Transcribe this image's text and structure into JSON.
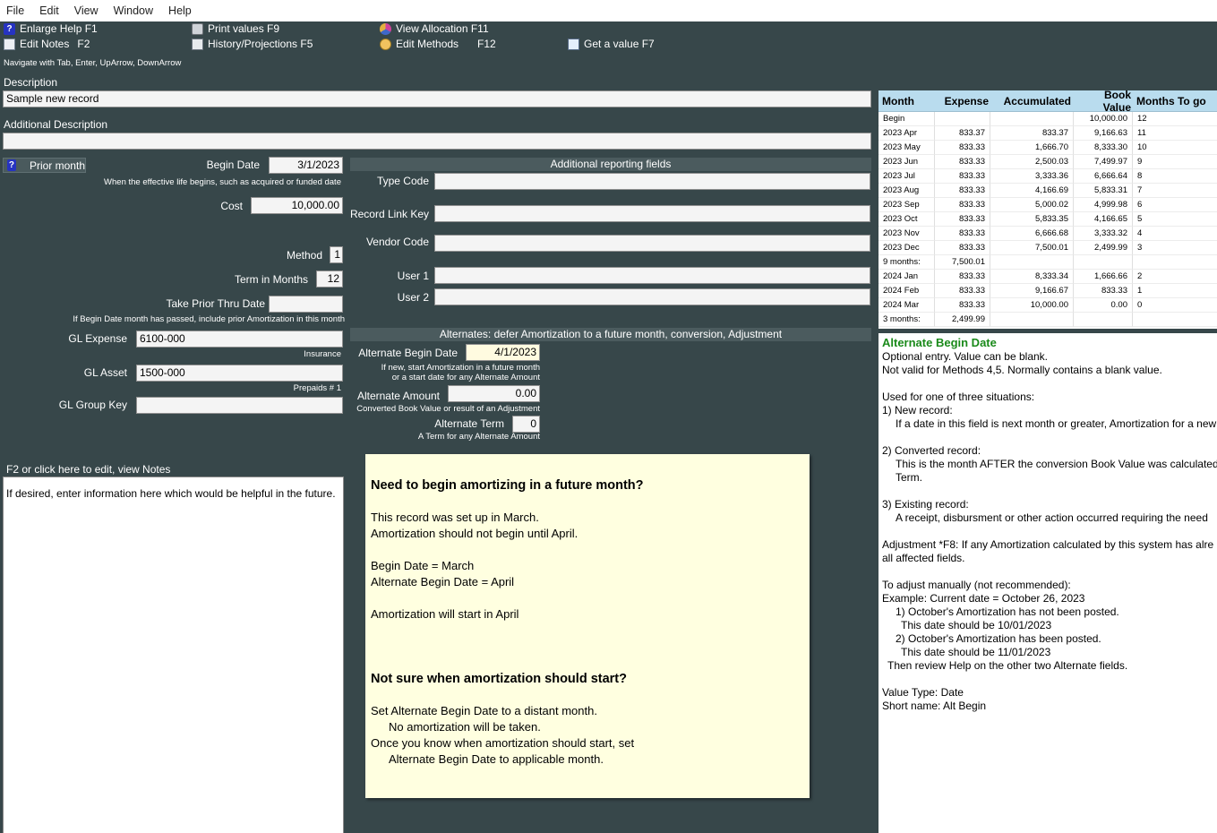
{
  "menu": [
    "File",
    "Edit",
    "View",
    "Window",
    "Help"
  ],
  "toolbar": {
    "enlarge_help": "Enlarge Help F1",
    "edit_notes": "Edit Notes",
    "edit_notes_key": "F2",
    "print_values": "Print values  F9",
    "history": "History/Projections  F5",
    "view_allocation": "View Allocation  F11",
    "edit_methods": "Edit Methods",
    "edit_methods_key": "F12",
    "get_value": "Get a value  F7"
  },
  "nav_hint": "Navigate with Tab, Enter, UpArrow, DownArrow",
  "description": {
    "label": "Description",
    "value": "Sample new record"
  },
  "additional_description": {
    "label": "Additional Description",
    "value": ""
  },
  "prior_month": {
    "icon": "?",
    "label": "Prior month"
  },
  "begin_date": {
    "label": "Begin Date",
    "value": "3/1/2023",
    "hint": "When the effective life begins, such as acquired or funded date"
  },
  "cost": {
    "label": "Cost",
    "value": "10,000.00"
  },
  "method": {
    "label": "Method",
    "value": "1"
  },
  "term": {
    "label": "Term in Months",
    "value": "12"
  },
  "take_prior": {
    "label": "Take Prior Thru Date",
    "value": "",
    "hint": "If Begin Date month has passed, include prior Amortization in this month"
  },
  "gl_expense": {
    "label": "GL Expense",
    "value": "6100-000",
    "desc": "Insurance"
  },
  "gl_asset": {
    "label": "GL Asset",
    "value": "1500-000",
    "desc": "Prepaids  # 1"
  },
  "gl_group": {
    "label": "GL Group Key",
    "value": ""
  },
  "notes": {
    "header": "F2 or click here to edit, view Notes",
    "text": "If desired, enter information here which would be helpful in the future."
  },
  "reporting": {
    "title": "Additional reporting fields",
    "type_code": {
      "label": "Type Code",
      "value": ""
    },
    "record_link": {
      "label": "Record Link Key",
      "value": ""
    },
    "vendor_code": {
      "label": "Vendor Code",
      "value": ""
    },
    "user1": {
      "label": "User 1",
      "value": ""
    },
    "user2": {
      "label": "User 2",
      "value": ""
    }
  },
  "alternates": {
    "title": "Alternates: defer Amortization to a future month, conversion, Adjustment",
    "begin_date": {
      "label": "Alternate Begin Date",
      "value": "4/1/2023",
      "hint1": "If new, start Amortization in a future month",
      "hint2": "or a start date for any Alternate Amount"
    },
    "amount": {
      "label": "Alternate Amount",
      "value": "0.00",
      "hint": "Converted Book Value or result of an Adjustment"
    },
    "term": {
      "label": "Alternate Term",
      "value": "0",
      "hint": "A Term for any Alternate Amount"
    }
  },
  "infobox": {
    "h1": "Need to begin amortizing in a future month?",
    "p1": "This record was set up in March.",
    "p2": "Amortization should not begin until April.",
    "p3": "Begin Date = March",
    "p4": "Alternate Begin Date = April",
    "p5": "Amortization will start in April",
    "h2": "Not sure when amortization should start?",
    "p6": "Set Alternate Begin Date to a distant month.",
    "p7": "No amortization will be taken.",
    "p8": "Once you know when amortization should start, set",
    "p9": "Alternate Begin Date to applicable month."
  },
  "schedule": {
    "headers": [
      "Month",
      "Expense",
      "Accumulated",
      "Book Value",
      "Months To go"
    ],
    "rows": [
      [
        "Begin",
        "",
        "",
        "10,000.00",
        "12"
      ],
      [
        "2023 Apr",
        "833.37",
        "833.37",
        "9,166.63",
        "11"
      ],
      [
        "2023 May",
        "833.33",
        "1,666.70",
        "8,333.30",
        "10"
      ],
      [
        "2023 Jun",
        "833.33",
        "2,500.03",
        "7,499.97",
        "9"
      ],
      [
        "2023 Jul",
        "833.33",
        "3,333.36",
        "6,666.64",
        "8"
      ],
      [
        "2023 Aug",
        "833.33",
        "4,166.69",
        "5,833.31",
        "7"
      ],
      [
        "2023 Sep",
        "833.33",
        "5,000.02",
        "4,999.98",
        "6"
      ],
      [
        "2023 Oct",
        "833.33",
        "5,833.35",
        "4,166.65",
        "5"
      ],
      [
        "2023 Nov",
        "833.33",
        "6,666.68",
        "3,333.32",
        "4"
      ],
      [
        "2023 Dec",
        "833.33",
        "7,500.01",
        "2,499.99",
        "3"
      ],
      [
        "9 months:",
        "7,500.01",
        "",
        "",
        ""
      ],
      [
        "2024 Jan",
        "833.33",
        "8,333.34",
        "1,666.66",
        "2"
      ],
      [
        "2024 Feb",
        "833.33",
        "9,166.67",
        "833.33",
        "1"
      ],
      [
        "2024 Mar",
        "833.33",
        "10,000.00",
        "0.00",
        "0"
      ],
      [
        "3 months:",
        "2,499.99",
        "",
        "",
        ""
      ]
    ]
  },
  "help": {
    "title": "Alternate Begin Date",
    "lines": [
      {
        "t": "Optional entry.  Value can be blank.",
        "c": ""
      },
      {
        "t": "Not valid for Methods 4,5.  Normally contains a blank value.",
        "c": ""
      },
      {
        "t": "",
        "c": "gap"
      },
      {
        "t": "Used for one of three situations:",
        "c": ""
      },
      {
        "t": "1) New record:",
        "c": ""
      },
      {
        "t": "If a date in this field is next month or greater, Amortization for a new",
        "c": "i1"
      },
      {
        "t": "",
        "c": "gap"
      },
      {
        "t": "2) Converted record:",
        "c": ""
      },
      {
        "t": "This is the month AFTER the conversion Book Value was calculated",
        "c": "i1"
      },
      {
        "t": "Term.",
        "c": "i1"
      },
      {
        "t": "",
        "c": "gap"
      },
      {
        "t": "3) Existing record:",
        "c": ""
      },
      {
        "t": "A receipt, disbursment or other action occurred requiring the need",
        "c": "i1"
      },
      {
        "t": "",
        "c": "gap"
      },
      {
        "t": "Adjustment *F8:  If any Amortization calculated by this system has alre",
        "c": ""
      },
      {
        "t": "all affected fields.",
        "c": ""
      },
      {
        "t": "",
        "c": "gap"
      },
      {
        "t": "To adjust manually (not recommended):",
        "c": ""
      },
      {
        "t": "Example: Current date = October 26, 2023",
        "c": ""
      },
      {
        "t": "1) October's Amortization has not been posted.",
        "c": "i1"
      },
      {
        "t": "This date should be 10/01/2023",
        "c": "i2"
      },
      {
        "t": "2) October's Amortization has been posted.",
        "c": "i1"
      },
      {
        "t": "This date should be 11/01/2023",
        "c": "i2"
      },
      {
        "t": "Then review Help on the other two Alternate fields.",
        "c": "i3"
      },
      {
        "t": "",
        "c": "gap"
      },
      {
        "t": "Value Type: Date",
        "c": ""
      },
      {
        "t": "Short name: Alt Begin",
        "c": ""
      }
    ]
  },
  "colors": {
    "background": "#37474a",
    "grid_header": "#b9dcee",
    "infobox": "#ffffe0",
    "help_title": "#1a8a1a"
  }
}
